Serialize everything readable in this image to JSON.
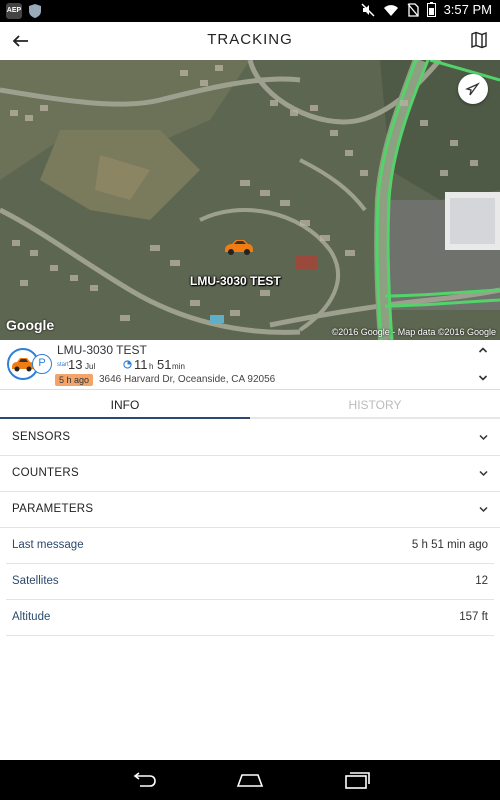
{
  "status_bar": {
    "left_badge": "AEP",
    "time": "3:57 PM"
  },
  "app_bar": {
    "title": "TRACKING"
  },
  "map": {
    "unit_label": "LMU-3030 TEST",
    "provider_logo": "Google",
    "copyright": "©2016 Google - Map data ©2016 Google"
  },
  "unit": {
    "name": "LMU-3030 TEST",
    "date_label": "start",
    "date_day": "13",
    "date_month": "Jul",
    "duration_hours": "11",
    "duration_hours_unit": "h",
    "duration_minutes": "51",
    "duration_minutes_unit": "min",
    "park_symbol": "P",
    "ago_badge": "5 h ago",
    "address": "3646 Harvard Dr, Oceanside, CA 92056",
    "colors": {
      "accent": "#2e7fd6",
      "badge": "#f2a46b"
    }
  },
  "tabs": [
    {
      "label": "INFO",
      "active": true
    },
    {
      "label": "HISTORY",
      "active": false
    }
  ],
  "sections": [
    {
      "label": "SENSORS"
    },
    {
      "label": "COUNTERS"
    },
    {
      "label": "PARAMETERS"
    }
  ],
  "info_rows": [
    {
      "key": "Last message",
      "value": "5 h 51 min ago"
    },
    {
      "key": "Satellites",
      "value": "12"
    },
    {
      "key": "Altitude",
      "value": "157 ft"
    }
  ],
  "icons": {
    "back": "arrow-left-icon",
    "map": "map-icon",
    "locate": "navigation-arrow-icon",
    "car": "car-icon",
    "park": "parking-icon",
    "clock": "clock-icon",
    "chevron_up": "chevron-up-icon",
    "chevron_down": "chevron-down-icon",
    "nav_back": "nav-back-icon",
    "nav_home": "nav-home-icon",
    "nav_recents": "nav-recents-icon"
  }
}
